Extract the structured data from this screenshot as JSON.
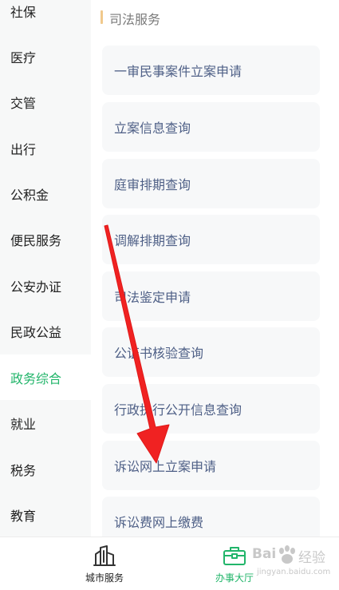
{
  "sidebar": {
    "items": [
      {
        "label": "社保"
      },
      {
        "label": "医疗"
      },
      {
        "label": "交管"
      },
      {
        "label": "出行"
      },
      {
        "label": "公积金"
      },
      {
        "label": "便民服务"
      },
      {
        "label": "公安办证"
      },
      {
        "label": "民政公益"
      },
      {
        "label": "政务综合",
        "active": true
      },
      {
        "label": "就业"
      },
      {
        "label": "税务"
      },
      {
        "label": "教育"
      }
    ]
  },
  "section": {
    "title": "司法服务"
  },
  "services": [
    {
      "label": "一审民事案件立案申请"
    },
    {
      "label": "立案信息查询"
    },
    {
      "label": "庭审排期查询"
    },
    {
      "label": "调解排期查询"
    },
    {
      "label": "司法鉴定申请"
    },
    {
      "label": "公证书核验查询"
    },
    {
      "label": "行政执行公开信息查询"
    },
    {
      "label": "诉讼网上立案申请"
    },
    {
      "label": "诉讼费网上缴费"
    }
  ],
  "tabbar": {
    "tabs": [
      {
        "label": "城市服务",
        "icon": "city-buildings-icon"
      },
      {
        "label": "办事大厅",
        "icon": "briefcase-icon",
        "active": true
      }
    ]
  },
  "colors": {
    "accent_green": "#21b56a",
    "arrow_red": "#f02222",
    "card_text": "#4e5f86",
    "section_bar": "#f0c98c"
  },
  "watermark": {
    "logo": "Bai",
    "logo_suffix": "经验",
    "url": "jingyan.baidu.com"
  }
}
